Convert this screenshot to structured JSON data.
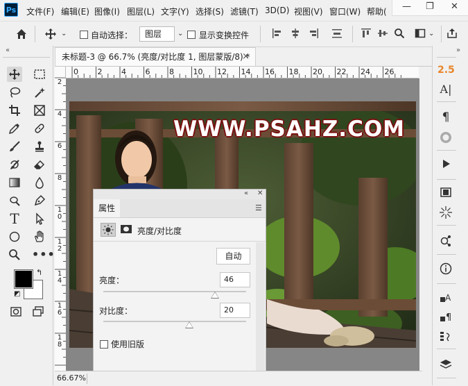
{
  "app": {
    "logo": "Ps"
  },
  "menu": [
    "文件(F)",
    "编辑(E)",
    "图像(I)",
    "图层(L)",
    "文字(Y)",
    "选择(S)",
    "滤镜(T)",
    "3D(D)",
    "视图(V)",
    "窗口(W)",
    "帮助("
  ],
  "window_controls": {
    "minimize": "—",
    "restore": "❐",
    "close": "✕"
  },
  "options_bar": {
    "auto_select_label": "自动选择：",
    "auto_select_target": "图层",
    "show_transform_label": "显示变换控件"
  },
  "document": {
    "tab_title": "未标题-3 @ 66.7% (亮度/对比度 1, 图层蒙版/8) *",
    "tab_close": "×",
    "ruler_top": [
      "0",
      "2",
      "4",
      "6",
      "8",
      "10",
      "12",
      "14",
      "16",
      "18",
      "20",
      "22",
      "24",
      "26"
    ],
    "ruler_left": [
      "2",
      "4",
      "6",
      "8",
      "1\n0",
      "1\n2",
      "1\n4",
      "1\n6",
      "1\n8"
    ],
    "zoom": "66.67%"
  },
  "image": {
    "watermark": "WWW.PSAHZ.COM"
  },
  "properties": {
    "collapse": "«",
    "close": "✕",
    "tab_label": "属性",
    "adjustment_name": "亮度/对比度",
    "auto_button": "自动",
    "brightness_label": "亮度：",
    "brightness_value": "46",
    "brightness_fraction": 0.78,
    "contrast_label": "对比度：",
    "contrast_value": "20",
    "contrast_fraction": 0.6,
    "legacy_label": "使用旧版"
  },
  "right_dock": {
    "value_badge": "2.5",
    "collapse": "»"
  },
  "left_toolbar": {
    "collapse": "«"
  },
  "colors": {
    "foreground": "#000000",
    "background": "#ffffff",
    "accent_orange": "#e8852a",
    "watermark_stroke": "#7a1010"
  }
}
